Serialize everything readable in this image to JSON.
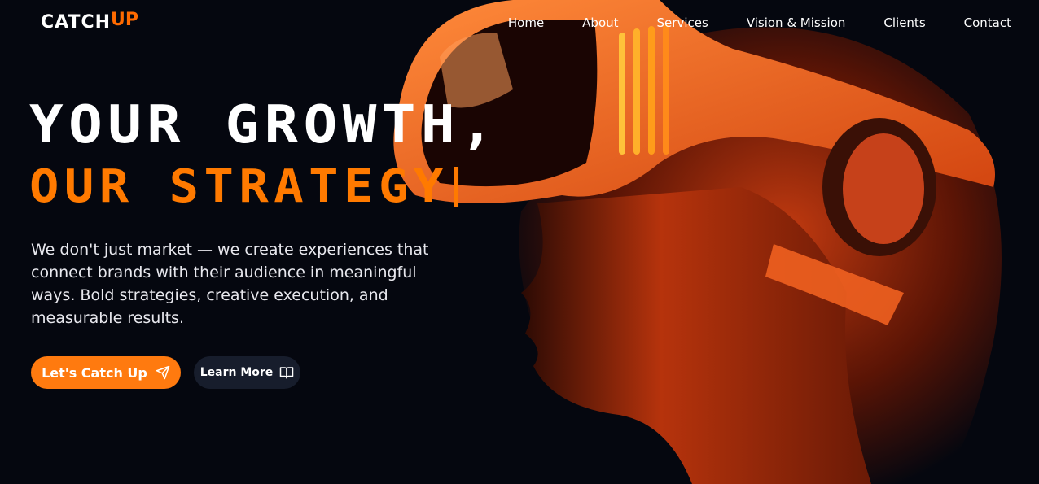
{
  "brand": {
    "logo_main": "CATCH",
    "logo_accent": "UP"
  },
  "nav": {
    "items": [
      "Home",
      "About",
      "Services",
      "Vision & Mission",
      "Clients",
      "Contact"
    ]
  },
  "hero": {
    "title_line1": "YOUR GROWTH,",
    "title_line2": "OUR STRATEGY",
    "description": "We don't just market — we create experiences that connect brands with their audience in meaningful ways. Bold strategies, creative execution, and measurable results.",
    "primary_button": "Let's Catch Up",
    "secondary_button": "Learn More"
  },
  "icons": {
    "primary_button": "send-icon",
    "secondary_button": "book-icon"
  },
  "colors": {
    "accent": "#ff7a00",
    "background": "#05070f",
    "secondary_button_bg": "#171d2c"
  }
}
